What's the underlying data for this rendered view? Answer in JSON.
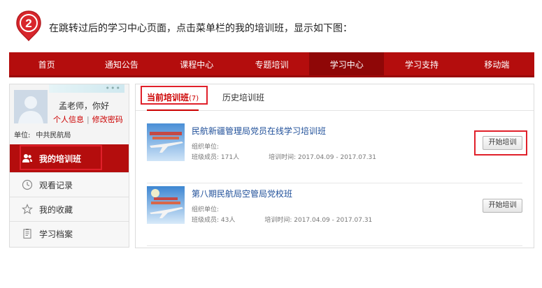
{
  "step": {
    "number": "2",
    "instruction": "在跳转过后的学习中心页面，点击菜单栏的我的培训班，显示如下图："
  },
  "nav": {
    "items": [
      {
        "label": "首页"
      },
      {
        "label": "通知公告"
      },
      {
        "label": "课程中心"
      },
      {
        "label": "专题培训"
      },
      {
        "label": "学习中心",
        "active": true
      },
      {
        "label": "学习支持"
      },
      {
        "label": "移动端"
      }
    ]
  },
  "user": {
    "greeting": "孟老师，你好",
    "profile_link": "个人信息",
    "separator": "|",
    "password_link": "修改密码",
    "unit_label": "单位:",
    "unit_value": "中共民航局",
    "dots": "•••"
  },
  "sidebar": {
    "items": [
      {
        "label": "我的培训班",
        "icon": "users-icon",
        "active": true
      },
      {
        "label": "观看记录",
        "icon": "clock-icon"
      },
      {
        "label": "我的收藏",
        "icon": "star-icon"
      },
      {
        "label": "学习档案",
        "icon": "document-icon"
      }
    ]
  },
  "tabs": {
    "current_label": "当前培训班",
    "current_count": "(7)",
    "history_label": "历史培训班"
  },
  "courses": [
    {
      "title": "民航新疆管理局党员在线学习培训班",
      "org_label": "组织单位:",
      "members": "班级成员: 171人",
      "period": "培训时间: 2017.04.09 - 2017.07.31",
      "button": "开始培训"
    },
    {
      "title": "第八期民航局空管局党校班",
      "org_label": "组织单位:",
      "members": "班级成员: 43人",
      "period": "培训时间: 2017.04.09 - 2017.07.31",
      "button": "开始培训"
    }
  ],
  "colors": {
    "brand_red": "#b40d0d",
    "highlight_red": "#e0202a",
    "link_blue": "#1f4f99"
  }
}
